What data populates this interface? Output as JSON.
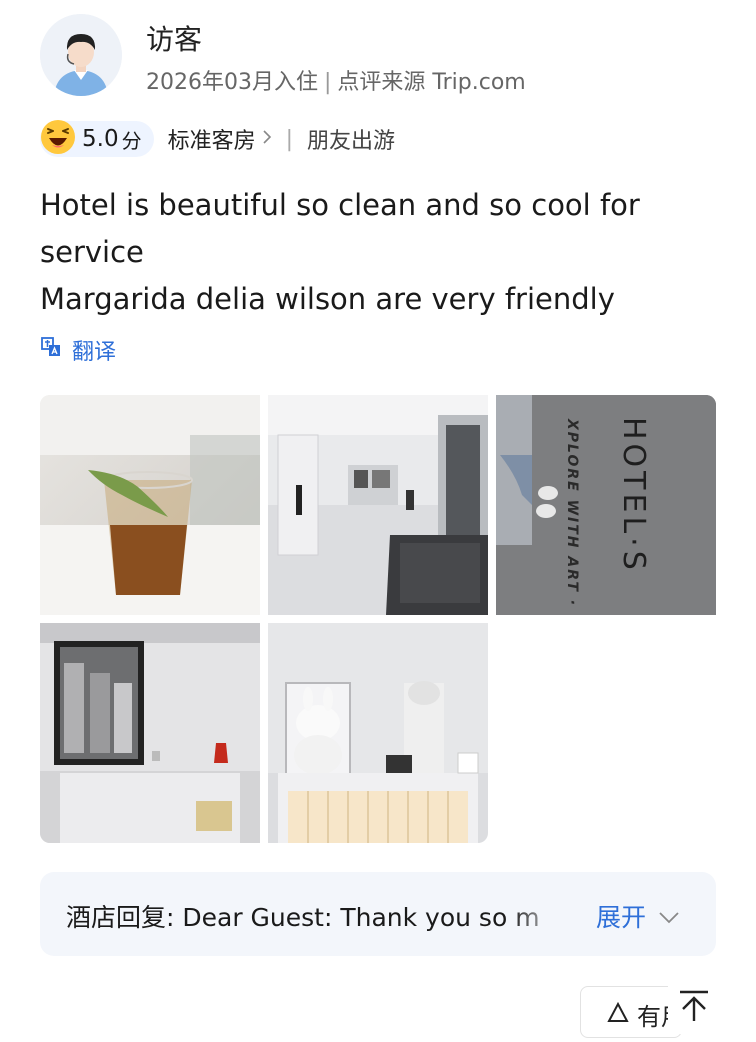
{
  "user": {
    "name": "访客",
    "stay_date": "2026年03月入住",
    "source": "点评来源 Trip.com"
  },
  "rating": {
    "score": "5.0",
    "unit": "分",
    "room_type": "标准客房",
    "trip_type": "朋友出游"
  },
  "review": {
    "line1": "Hotel is beautiful so clean and so cool for service",
    "line2": "Margarida delia wilson are very friendly"
  },
  "translate_label": "翻译",
  "photos": {
    "count": 5,
    "p3_mat_text": "HOTEL·S",
    "p3_mat_subtext": "XPLORE WITH ART ·"
  },
  "hotel_reply": {
    "text": "酒店回复: Dear Guest: Thank you so m",
    "expand_label": "展开"
  },
  "helpful_label": "有用",
  "colors": {
    "accent": "#2e6fd8",
    "reply_bg": "#f3f6fb",
    "score_pill_bg": "#eef4ff"
  },
  "icons": [
    "avatar",
    "laughing-emoji-icon",
    "chevron-right-icon",
    "translate-icon",
    "chevron-down-icon",
    "thumbs-up-icon",
    "back-to-top-icon"
  ]
}
